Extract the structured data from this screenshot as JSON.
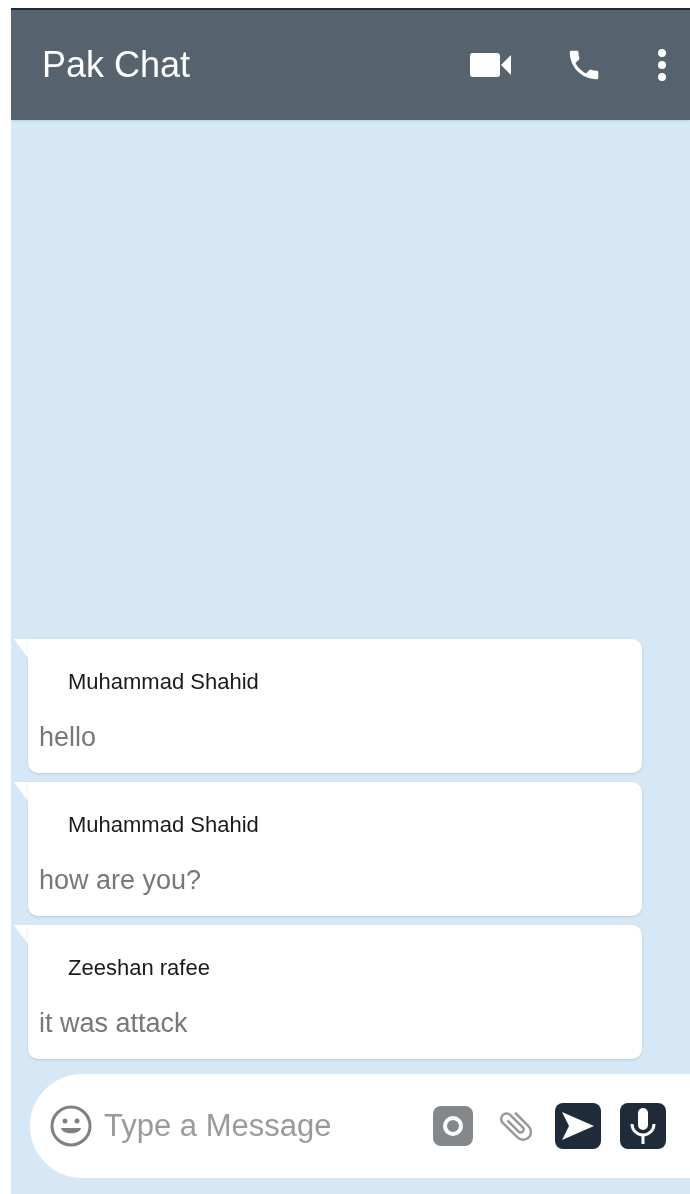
{
  "header": {
    "title": "Pak Chat"
  },
  "messages": [
    {
      "sender": "Muhammad Shahid",
      "text": "hello"
    },
    {
      "sender": "Muhammad Shahid",
      "text": "how are you?"
    },
    {
      "sender": "Zeeshan rafee",
      "text": "it was attack"
    }
  ],
  "composer": {
    "placeholder": "Type a Message"
  }
}
